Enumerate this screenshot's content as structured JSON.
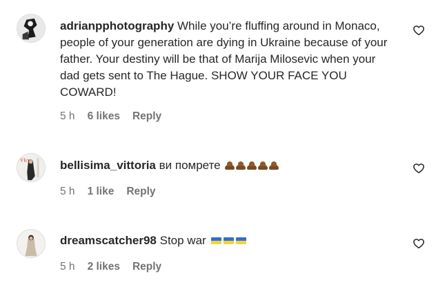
{
  "comments": [
    {
      "username": "adrianpphotography",
      "text": "While you’re fluffing around in Monaco, people of your generation are dying in Ukraine because of your father. Your destiny will be that of Marija Milosevic when your dad gets sent to The Hague. SHOW YOUR FACE YOU COWARD!",
      "time": "5 h",
      "likes": "6 likes",
      "reply": "Reply",
      "avatar_icon": "avatar-photo-icon",
      "like_icon": "heart-outline-icon"
    },
    {
      "username": "bellisima_vittoria",
      "text": "ви помрете",
      "emojis": [
        "poop",
        "poop",
        "poop",
        "poop",
        "poop"
      ],
      "time": "5 h",
      "likes": "1 like",
      "reply": "Reply",
      "avatar_icon": "avatar-photo-icon",
      "like_icon": "heart-outline-icon"
    },
    {
      "username": "dreamscatcher98",
      "text": "Stop war",
      "emojis": [
        "ukraine-flag",
        "ukraine-flag",
        "ukraine-flag"
      ],
      "time": "5 h",
      "likes": "2 likes",
      "reply": "Reply",
      "avatar_icon": "avatar-photo-icon",
      "like_icon": "heart-outline-icon"
    }
  ],
  "colors": {
    "text": "#262626",
    "meta": "#737373",
    "flag_blue": "#2f6fd6",
    "flag_yellow": "#f7d23a"
  }
}
